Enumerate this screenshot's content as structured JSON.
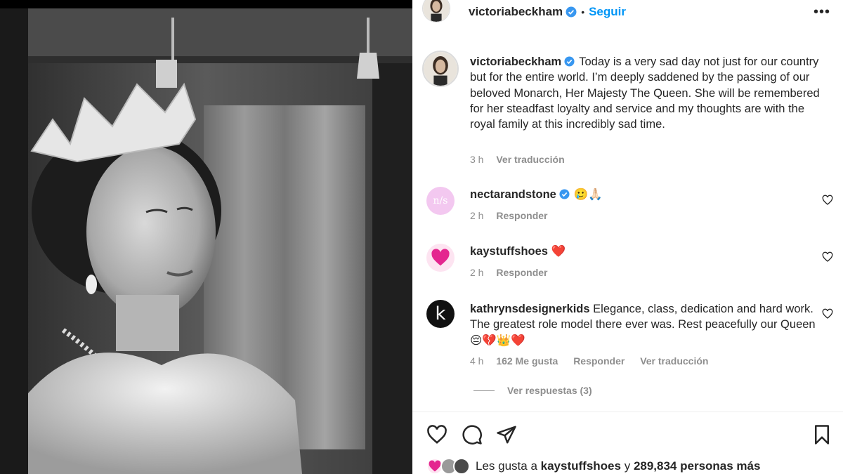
{
  "post": {
    "author": "victoriabeckham",
    "follow_label": "Seguir",
    "dot": "•",
    "more": "•••"
  },
  "caption": {
    "username": "victoriabeckham",
    "text": "Today is a very sad day not just for our country but for the entire world. I’m deeply saddened by the passing of our beloved Monarch, Her Majesty The Queen. She will be remembered for her steadfast loyalty and service and my thoughts are with the royal family at this incredibly sad time.",
    "time": "3 h",
    "translate": "Ver traducción"
  },
  "comments": [
    {
      "username": "nectarandstone",
      "verified": true,
      "text": "🥲🙏🏻",
      "time": "2 h",
      "reply": "Responder",
      "avatar_color": "#f1c6ee",
      "avatar_text": "n/s"
    },
    {
      "username": "kaystuffshoes",
      "verified": false,
      "text": "❤️",
      "time": "2 h",
      "reply": "Responder",
      "avatar_color": "#e4268f"
    },
    {
      "username": "kathrynsdesignerkids",
      "verified": false,
      "text": "Elegance, class, dedication and hard work. The greatest role model there ever was. Rest peacefully our Queen 😔💔👑❤️",
      "time": "4 h",
      "likes": "162 Me gusta",
      "reply": "Responder",
      "translate": "Ver traducción",
      "avatar_color": "#111111",
      "avatar_text": "k"
    }
  ],
  "view_replies": "Ver respuestas (3)",
  "likes": {
    "prefix": "Les gusta a",
    "user": "kaystuffshoes",
    "and": "y",
    "count": "289,834 personas más"
  },
  "icons": {
    "verified": "verified-badge-icon",
    "like": "heart-icon",
    "comment": "comment-icon",
    "share": "send-icon",
    "save": "bookmark-icon",
    "more": "more-options-icon"
  },
  "colors": {
    "link": "#0095f6",
    "verified": "#3897f0",
    "muted": "#8e8e8e",
    "text": "#262626"
  }
}
